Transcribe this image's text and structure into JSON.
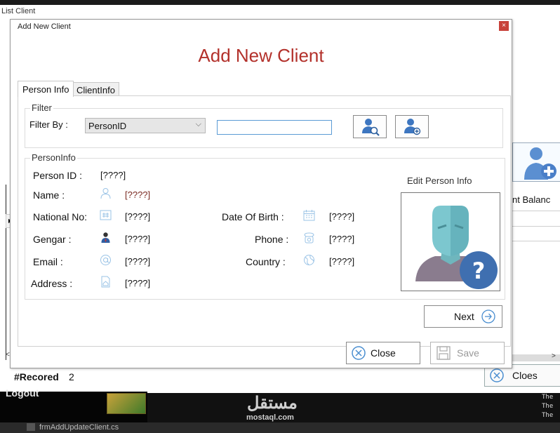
{
  "background": {
    "list_window_title": "List Client",
    "balance_column_header": "nt Balanc",
    "record_label": "#Recored",
    "record_count": "2",
    "close_button_label": "Cloes",
    "logout_label": "Logout",
    "file_tab": "frmAddUpdateClient.cs",
    "console_lines": [
      "The",
      "The",
      "The"
    ],
    "watermark": {
      "arabic": "مستقل",
      "latin": "mostaql.com"
    }
  },
  "dialog": {
    "window_title": "Add New Client",
    "close_glyph": "×",
    "header_title": "Add New Client",
    "tabs": [
      {
        "label": "Person Info",
        "active": true
      },
      {
        "label": "ClientInfo",
        "active": false
      }
    ],
    "filter": {
      "group_title": "Filter",
      "label": "Filter By :",
      "selected_option": "PersonID",
      "search_value": "",
      "icons": [
        "find-person-icon",
        "add-person-icon"
      ]
    },
    "person_info": {
      "group_title": "PersonInfo",
      "person_id_label": "Person ID :",
      "person_id_value": "[????]",
      "name_label": "Name :",
      "name_value": "[????]",
      "national_no_label": "National No:",
      "national_no_value": "[????]",
      "gender_label": "Gengar :",
      "gender_value": "[????]",
      "email_label": "Email :",
      "email_value": "[????]",
      "address_label": "Address :",
      "address_value": "[????]",
      "dob_label": "Date Of Birth :",
      "dob_value": "[????]",
      "phone_label": "Phone :",
      "phone_value": "[????]",
      "country_label": "Country :",
      "country_value": "[????]",
      "edit_link": "Edit Person Info"
    },
    "buttons": {
      "next": "Next",
      "close": "Close",
      "save": "Save"
    }
  },
  "colors": {
    "header_red": "#b3312b",
    "accent_blue": "#5a9bd5",
    "close_red": "#c8423a"
  }
}
